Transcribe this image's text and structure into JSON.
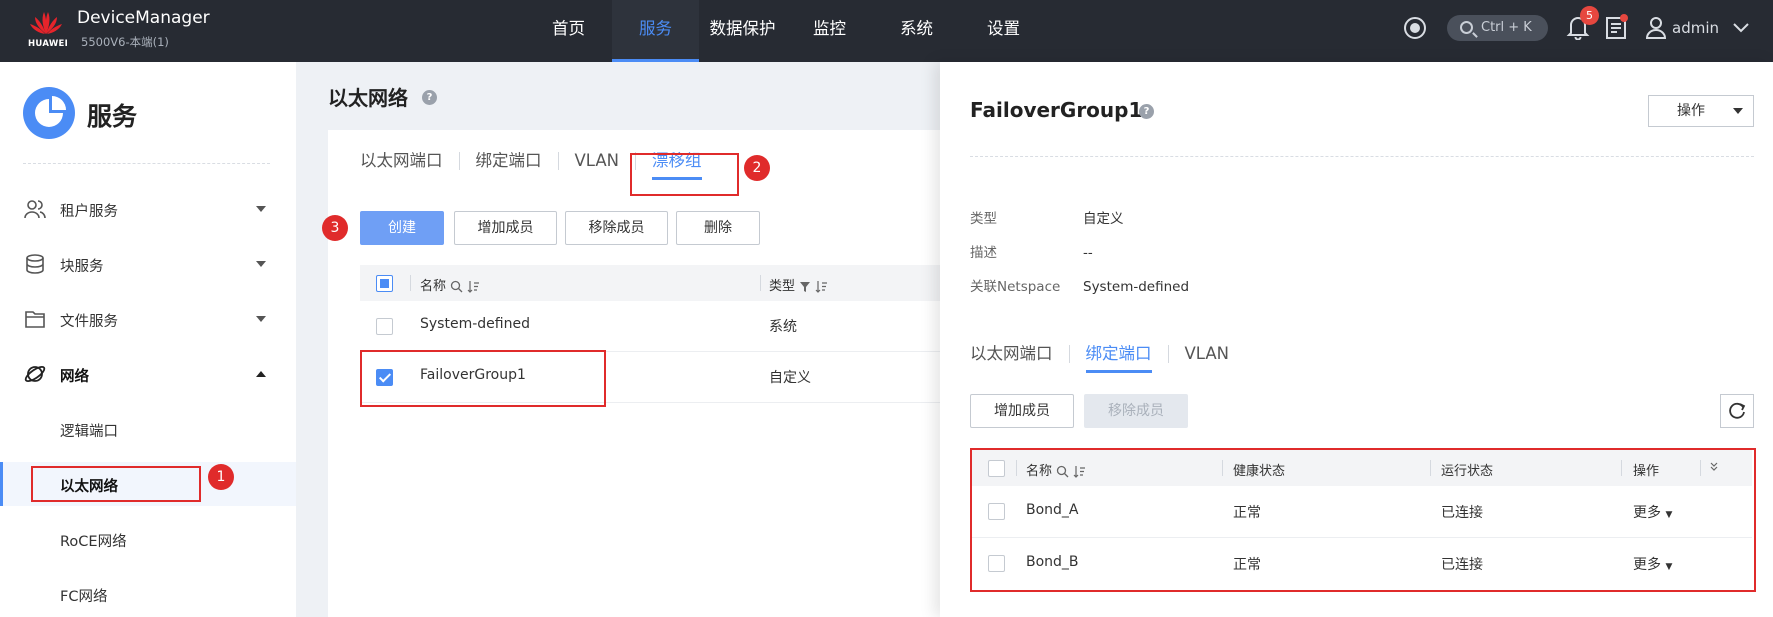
{
  "topbar": {
    "brand": "HUAWEI",
    "app_title": "DeviceManager",
    "app_subtitle": "5500V6-本端(1)",
    "nav": [
      {
        "label": "首页",
        "active": false
      },
      {
        "label": "服务",
        "active": true
      },
      {
        "label": "数据保护",
        "active": false
      },
      {
        "label": "监控",
        "active": false
      },
      {
        "label": "系统",
        "active": false
      },
      {
        "label": "设置",
        "active": false
      }
    ],
    "search_shortcut": "Ctrl + K",
    "notification_count": "5",
    "username": "admin",
    "accent_color": "#4b8cf5",
    "bg_color": "#272b33"
  },
  "sidebar": {
    "title": "服务",
    "groups": [
      {
        "label": "租户服务",
        "icon": "tenant-icon",
        "expanded": false
      },
      {
        "label": "块服务",
        "icon": "database-icon",
        "expanded": false
      },
      {
        "label": "文件服务",
        "icon": "folder-icon",
        "expanded": false
      },
      {
        "label": "网络",
        "icon": "network-planet-icon",
        "expanded": true
      }
    ],
    "network_items": [
      {
        "label": "逻辑端口",
        "active": false
      },
      {
        "label": "以太网络",
        "active": true
      },
      {
        "label": "RoCE网络",
        "active": false
      },
      {
        "label": "FC网络",
        "active": false
      }
    ]
  },
  "main": {
    "title": "以太网络",
    "tabs": [
      {
        "label": "以太网端口",
        "active": false
      },
      {
        "label": "绑定端口",
        "active": false
      },
      {
        "label": "VLAN",
        "active": false
      },
      {
        "label": "漂移组",
        "active": true
      }
    ],
    "toolbar": {
      "create": "创建",
      "add_member": "增加成员",
      "remove_member": "移除成员",
      "delete": "删除"
    },
    "table": {
      "columns": [
        "名称",
        "类型"
      ],
      "rows": [
        {
          "name": "System-defined",
          "type": "系统",
          "checked": false
        },
        {
          "name": "FailoverGroup1",
          "type": "自定义",
          "checked": true
        }
      ]
    }
  },
  "drawer": {
    "title": "FailoverGroup1",
    "operation_button": "操作",
    "details": [
      {
        "key": "类型",
        "value": "自定义"
      },
      {
        "key": "描述",
        "value": "--"
      },
      {
        "key": "关联Netspace",
        "value": "System-defined"
      }
    ],
    "tabs": [
      {
        "label": "以太网端口",
        "active": false
      },
      {
        "label": "绑定端口",
        "active": true
      },
      {
        "label": "VLAN",
        "active": false
      }
    ],
    "toolbar": {
      "add_member": "增加成员",
      "remove_member": "移除成员"
    },
    "table": {
      "columns": [
        "名称",
        "健康状态",
        "运行状态",
        "操作"
      ],
      "rows": [
        {
          "name": "Bond_A",
          "health": "正常",
          "running": "已连接",
          "action": "更多"
        },
        {
          "name": "Bond_B",
          "health": "正常",
          "running": "已连接",
          "action": "更多"
        }
      ]
    }
  },
  "annotations": {
    "callouts": [
      "1",
      "2",
      "3"
    ],
    "highlight_color": "#e02b2b"
  }
}
